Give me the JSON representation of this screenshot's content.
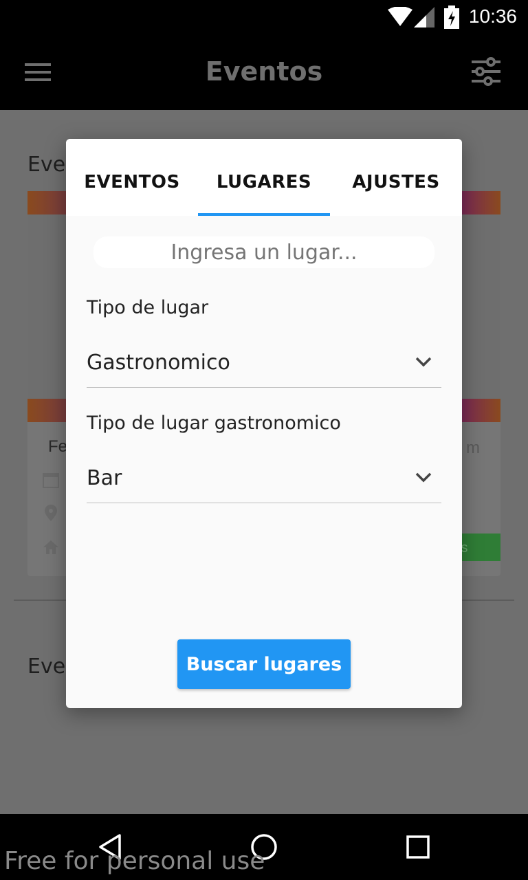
{
  "status_bar": {
    "time": "10:36"
  },
  "app_bar": {
    "title": "Eventos"
  },
  "background": {
    "section_title_1": "Eve",
    "section_title_2": "Eve",
    "card_title": "Fe",
    "card_title_extra": "m",
    "card_button_text": "is"
  },
  "dialog": {
    "tabs": [
      {
        "label": "EVENTOS",
        "active": false
      },
      {
        "label": "LUGARES",
        "active": true
      },
      {
        "label": "AJUSTES",
        "active": false
      }
    ],
    "search": {
      "placeholder": "Ingresa un lugar..."
    },
    "field_1": {
      "label": "Tipo de lugar",
      "value": "Gastronomico"
    },
    "field_2": {
      "label": "Tipo de lugar gastronomico",
      "value": "Bar"
    },
    "submit_label": "Buscar lugares"
  },
  "watermark": "Free for personal use",
  "colors": {
    "accent": "#2196f3",
    "dialog_bg": "#fafafa",
    "scrim": "#6f6f6f"
  }
}
